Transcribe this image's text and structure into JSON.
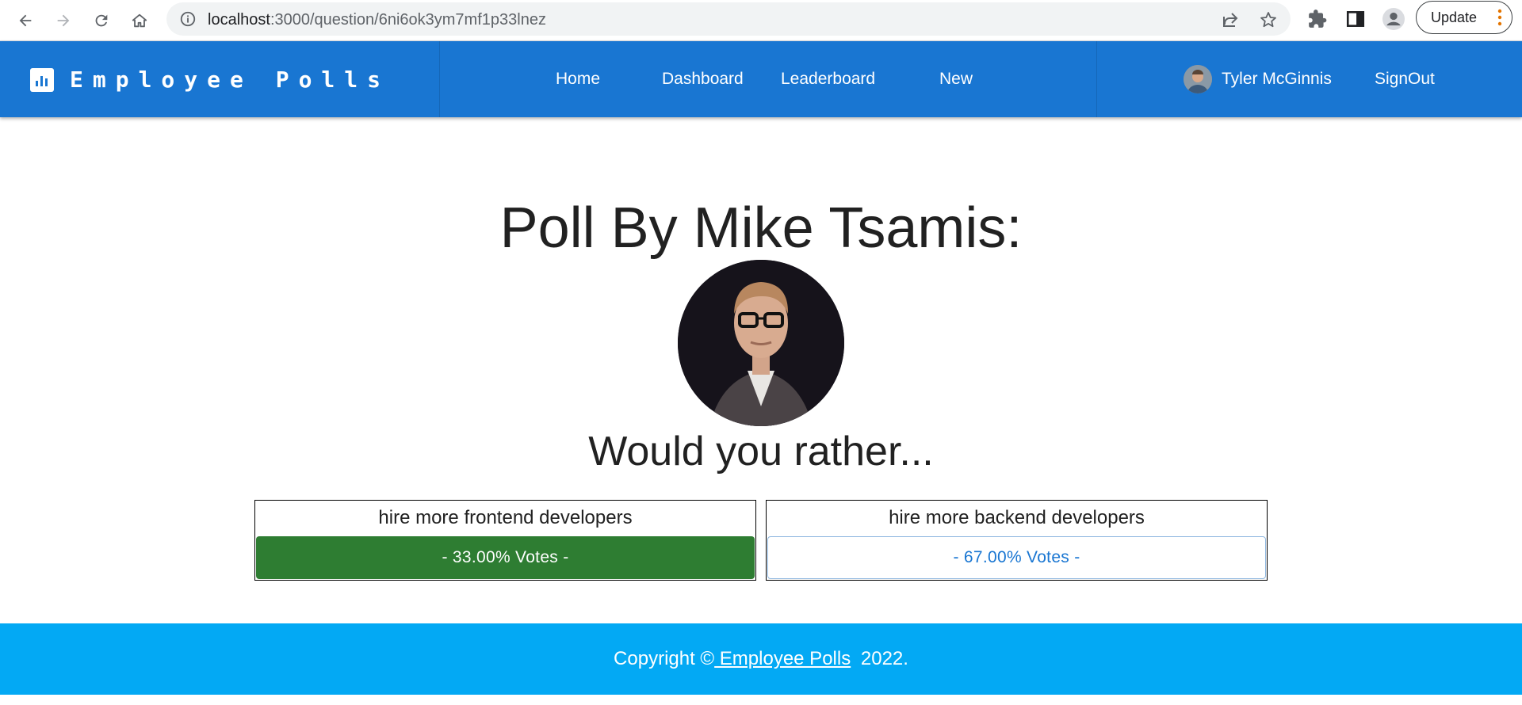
{
  "browser": {
    "url_host": "localhost",
    "url_path": ":3000/question/6ni6ok3ym7mf1p33lnez",
    "update_label": "Update"
  },
  "header": {
    "brand": "Employee Polls",
    "nav": [
      "Home",
      "Dashboard",
      "Leaderboard",
      "New"
    ],
    "user_name": "Tyler McGinnis",
    "signout_label": "SignOut"
  },
  "poll": {
    "title": "Poll By Mike Tsamis:",
    "prompt": "Would you rather...",
    "options": [
      {
        "text": "hire more frontend developers",
        "votes_label": "- 33.00% Votes -",
        "chosen": true
      },
      {
        "text": "hire more backend developers",
        "votes_label": "- 67.00% Votes -",
        "chosen": false
      }
    ]
  },
  "footer": {
    "prefix": "Copyright ©",
    "link": " Employee Polls",
    "suffix": " 2022."
  },
  "colors": {
    "header": "#1976d2",
    "footer": "#03a9f4",
    "chosen": "#2e7d32"
  }
}
